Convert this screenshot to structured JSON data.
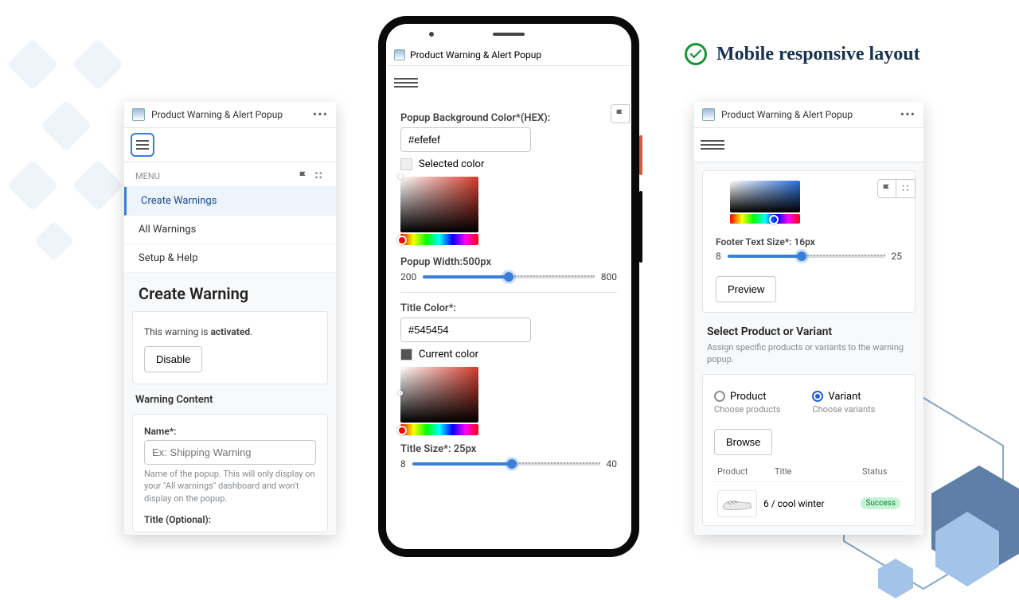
{
  "heading": "Mobile responsive layout",
  "app_title": "Product Warning & Alert Popup",
  "left": {
    "menu_label": "MENU",
    "items": [
      "Create Warnings",
      "All Warnings",
      "Setup & Help"
    ],
    "page_title": "Create Warning",
    "status_prefix": "This warning is ",
    "status_word": "activated",
    "status_suffix": ".",
    "disable_btn": "Disable",
    "section_title": "Warning Content",
    "name_label": "Name*:",
    "name_placeholder": "Ex: Shipping Warning",
    "name_help": "Name of the popup. This will only display on your \"All warnings\" dashboard and won't display on the popup.",
    "title_label": "Title (Optional):"
  },
  "phone": {
    "bg_label": "Popup Background Color*(HEX):",
    "bg_value": "#efefef",
    "selected_color": "Selected color",
    "width_label": "Popup Width:500px",
    "width_min": "200",
    "width_max": "800",
    "title_color_label": "Title Color*:",
    "title_color_value": "#545454",
    "current_color": "Current color",
    "title_size_label": "Title Size*: 25px",
    "title_min": "8",
    "title_max": "40"
  },
  "right": {
    "footer_size_label": "Footer Text Size*: 16px",
    "footer_min": "8",
    "footer_max": "25",
    "preview_btn": "Preview",
    "select_title": "Select Product or Variant",
    "select_desc": "Assign specific products or variants to the warning popup.",
    "product_label": "Product",
    "variant_label": "Variant",
    "product_sub": "Choose products",
    "variant_sub": "Choose variants",
    "browse_btn": "Browse",
    "col_product": "Product",
    "col_title": "Title",
    "col_status": "Status",
    "row_title": "6 / cool winter",
    "row_status": "Success"
  }
}
